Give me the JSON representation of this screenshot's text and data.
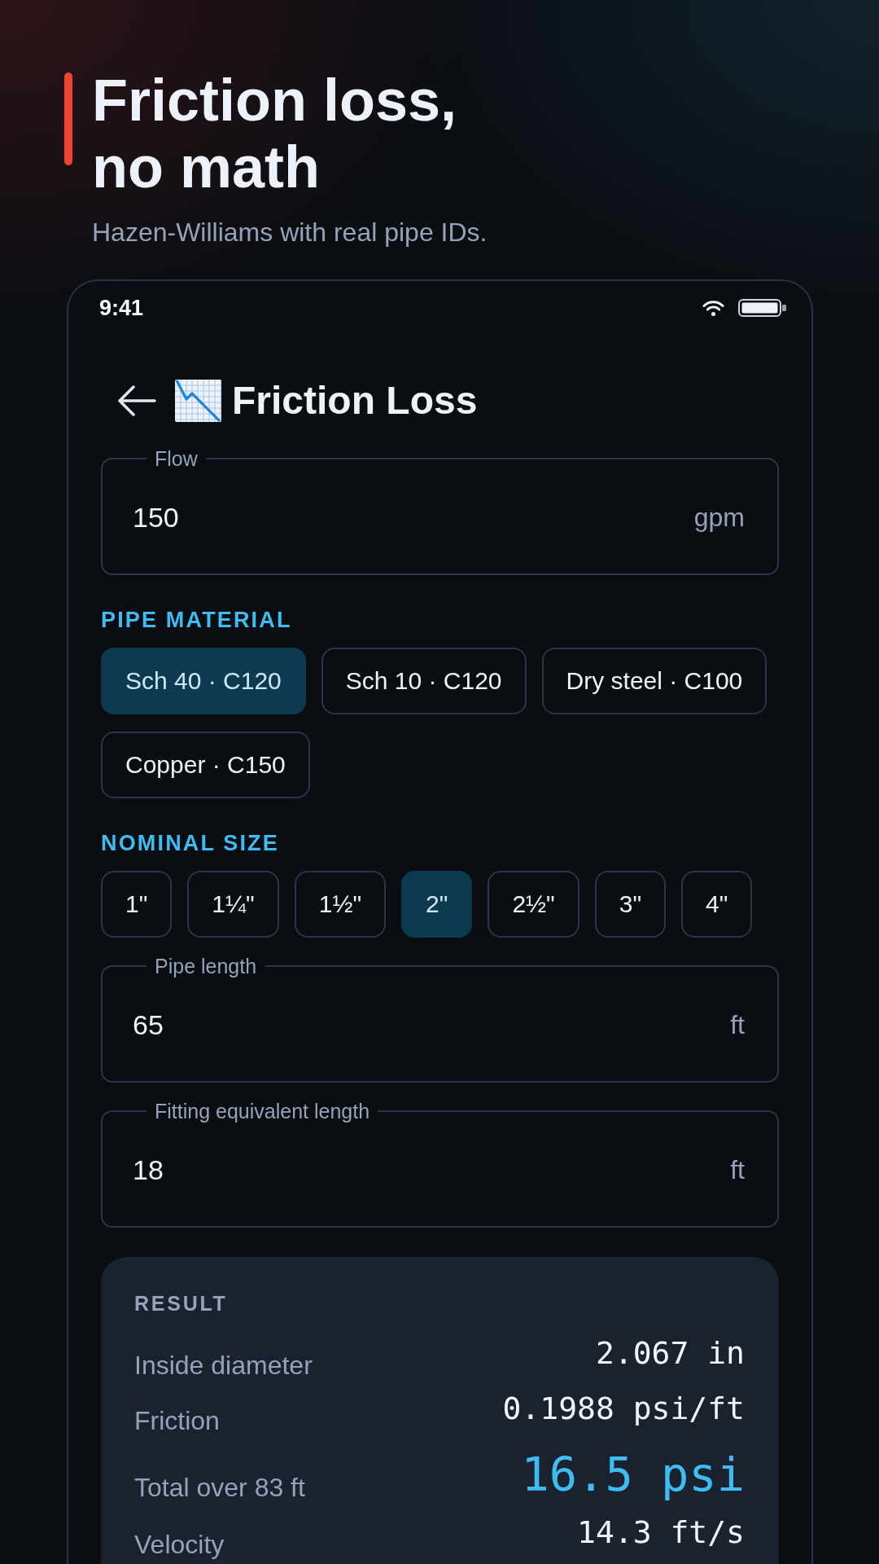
{
  "hero": {
    "title": "Friction loss, no math",
    "subtitle": "Hazen-Williams with real pipe IDs."
  },
  "status_bar": {
    "time": "9:41"
  },
  "app_bar": {
    "title": "Friction Loss"
  },
  "form": [
    {
      "kind": "field",
      "label": "Flow",
      "value": "150",
      "unit": "gpm"
    },
    {
      "kind": "chips",
      "title": "PIPE MATERIAL",
      "options": [
        {
          "label": "Sch 40 · C120",
          "selected": true
        },
        {
          "label": "Sch 10 · C120",
          "selected": false
        },
        {
          "label": "Dry steel · C100",
          "selected": false
        },
        {
          "label": "Copper · C150",
          "selected": false
        }
      ]
    },
    {
      "kind": "chips",
      "title": "NOMINAL SIZE",
      "options": [
        {
          "label": "1\"",
          "selected": false
        },
        {
          "label": "1¼\"",
          "selected": false
        },
        {
          "label": "1½\"",
          "selected": false
        },
        {
          "label": "2\"",
          "selected": true
        },
        {
          "label": "2½\"",
          "selected": false
        },
        {
          "label": "3\"",
          "selected": false
        },
        {
          "label": "4\"",
          "selected": false
        }
      ]
    },
    {
      "kind": "field",
      "label": "Pipe length",
      "value": "65",
      "unit": "ft"
    },
    {
      "kind": "field",
      "label": "Fitting equivalent length",
      "value": "18",
      "unit": "ft"
    }
  ],
  "result": {
    "title": "RESULT",
    "rows": [
      {
        "label": "Inside diameter",
        "value": "2.067 in",
        "emphasis": false
      },
      {
        "label": "Friction",
        "value": "0.1988 psi/ft",
        "emphasis": false
      },
      {
        "label": "Total over 83 ft",
        "value": "16.5 psi",
        "emphasis": true
      },
      {
        "label": "Velocity",
        "value": "14.3 ft/s",
        "emphasis": false
      }
    ]
  }
}
